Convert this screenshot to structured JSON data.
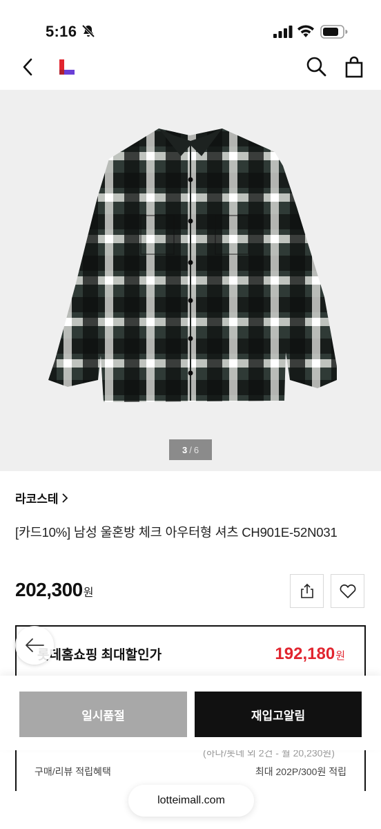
{
  "status_bar": {
    "time": "5:16"
  },
  "nav": {
    "back_icon": "chevron-left-icon",
    "logo": "lotte-l-logo",
    "search_icon": "search-icon",
    "bag_icon": "shopping-bag-icon"
  },
  "product": {
    "image_counter": {
      "current": "3",
      "separator": "/",
      "total": "6"
    },
    "brand": "라코스테",
    "title": "[카드10%] 남성 울혼방 체크 아우터형 셔츠 CH901E-52N031",
    "price": "202,300",
    "price_unit": "원"
  },
  "discount": {
    "label": "롯데홈쇼핑 최대할인가",
    "price": "192,180",
    "price_unit": "원",
    "partial_line": "(하나/롯데 외 2건 - 월 20,230원)",
    "reward_label": "구매/리뷰 적립혜택",
    "reward_value": "최대 202P/300원 적립"
  },
  "actions": {
    "soldout_label": "일시품절",
    "restock_label": "재입고알림"
  },
  "browser": {
    "url": "lotteimall.com"
  },
  "colors": {
    "accent_red": "#e1252f",
    "logo_red": "#e1252f",
    "logo_purple": "#6a3fd6",
    "dark": "#111111",
    "disabled": "#a8a8a8"
  }
}
